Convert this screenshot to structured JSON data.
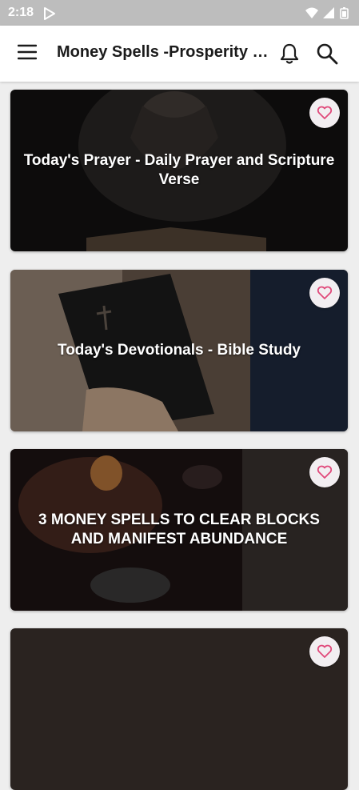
{
  "status_bar": {
    "time": "2:18",
    "icons": [
      "play-store-icon",
      "wifi-icon",
      "signal-icon",
      "battery-icon"
    ]
  },
  "app_bar": {
    "title": "Money Spells -Prosperity Spells",
    "icons": [
      "menu-icon",
      "bell-icon",
      "search-icon"
    ]
  },
  "colors": {
    "status_bar": "#bdbdbd",
    "app_bar": "#ffffff",
    "background": "#eeeeee",
    "heart": "#e0487a",
    "heart_button": "#f2eef1"
  },
  "cards": [
    {
      "title": "Today's Prayer - Daily Prayer and Scripture Verse",
      "favorite": false
    },
    {
      "title": "Today's Devotionals - Bible Study",
      "favorite": false
    },
    {
      "title": "3 MONEY SPELLS TO CLEAR BLOCKS AND MANIFEST ABUNDANCE",
      "favorite": false
    },
    {
      "title": "",
      "favorite": false
    }
  ]
}
